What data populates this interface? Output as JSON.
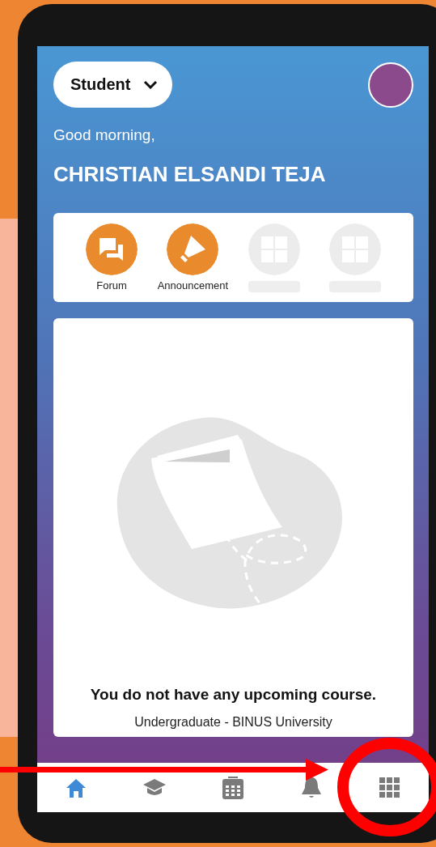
{
  "role_selector": {
    "label": "Student"
  },
  "greeting": "Good morning,",
  "user_name": "CHRISTIAN ELSANDI TEJA",
  "shortcuts": [
    {
      "kind": "forum",
      "label": "Forum"
    },
    {
      "kind": "announcement",
      "label": "Announcement"
    },
    {
      "kind": "placeholder"
    },
    {
      "kind": "placeholder"
    }
  ],
  "empty_state": {
    "message": "You do not have any upcoming course.",
    "subtitle": "Undergraduate - BINUS University"
  },
  "bottom_nav": [
    {
      "kind": "home",
      "selected": true
    },
    {
      "kind": "courses",
      "selected": false
    },
    {
      "kind": "calendar",
      "selected": false
    },
    {
      "kind": "notifications",
      "selected": false
    },
    {
      "kind": "apps",
      "selected": false
    }
  ]
}
